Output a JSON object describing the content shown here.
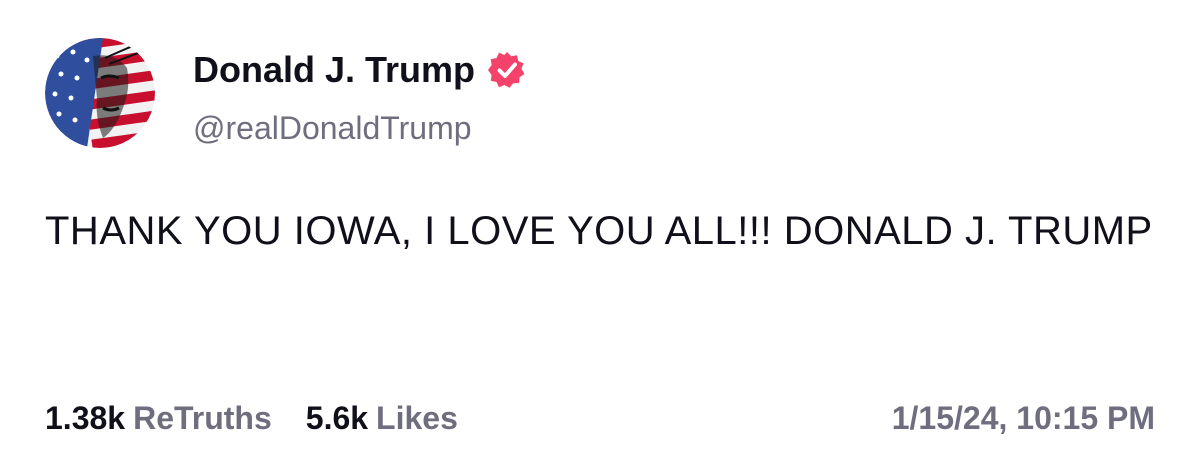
{
  "author": {
    "display_name": "Donald J. Trump",
    "handle": "@realDonaldTrump",
    "avatar_icon": "flag-portrait-avatar",
    "verified_icon": "verified-badge-icon",
    "verified_color": "#f4426b"
  },
  "post": {
    "text": "THANK YOU IOWA, I LOVE YOU ALL!!! DONALD J. TRUMP"
  },
  "stats": {
    "retruths_count": "1.38k",
    "retruths_label": "ReTruths",
    "likes_count": "5.6k",
    "likes_label": "Likes"
  },
  "timestamp": "1/15/24, 10:15 PM",
  "colors": {
    "text_primary": "#10101a",
    "text_secondary": "#6f6e7f",
    "background": "#ffffff"
  }
}
